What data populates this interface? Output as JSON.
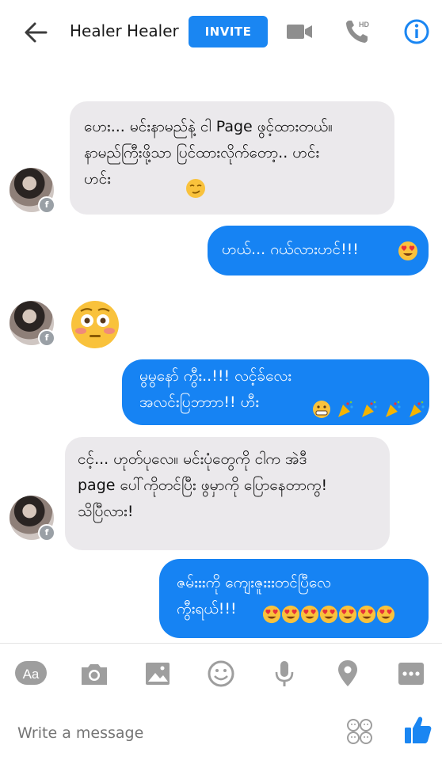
{
  "header": {
    "contact_name": "Healer Healer",
    "invite_label": "INVITE",
    "phone_badge": "HD"
  },
  "messages": [
    {
      "side": "incoming",
      "text": "ဟေး... မင်းနာမည်နဲ့ ငါ Page ဖွင့်ထားတယ်။\nနာမည်ကြီးဖို့သာ ပြင်ထားလိုက်တော့.. ဟင်း\nဟင်း"
    },
    {
      "side": "outgoing",
      "text": "ဟယ်... ဂယ်လားဟင်!!!"
    },
    {
      "side": "incoming",
      "text": ""
    },
    {
      "side": "outgoing",
      "text": "မွမွနော် ကွီး..!!! လင့်ခ်လေး\nအလင်းပြဘာာာ!! ဟီး"
    },
    {
      "side": "incoming",
      "text": "ငင့်... ဟုတ်ပုလေ။ မင်းပုံတွေကို ငါက အဲဒီ\npage ပေါ်ကိုတင်ပြီး ဖွမှာကို ပြောနေတာကွ!\nသိပြီလား!"
    },
    {
      "side": "outgoing",
      "text": "ဇမ်းးးကို ကျေးဇူးးးတင်ပြီလေ\nကွီးရယ်!!!"
    }
  ],
  "composer": {
    "placeholder": "Write a message"
  },
  "colors": {
    "accent": "#1a86f2",
    "outgoing_bubble": "#1683f3",
    "incoming_bubble": "#ebe9ec",
    "icon_gray": "#a6a6a6"
  },
  "icons": [
    "back-arrow-icon",
    "video-call-icon",
    "phone-call-icon",
    "info-icon",
    "text-format-icon",
    "camera-icon",
    "image-icon",
    "sticker-icon",
    "microphone-icon",
    "location-icon",
    "more-icon",
    "emoji-icon",
    "like-icon"
  ]
}
